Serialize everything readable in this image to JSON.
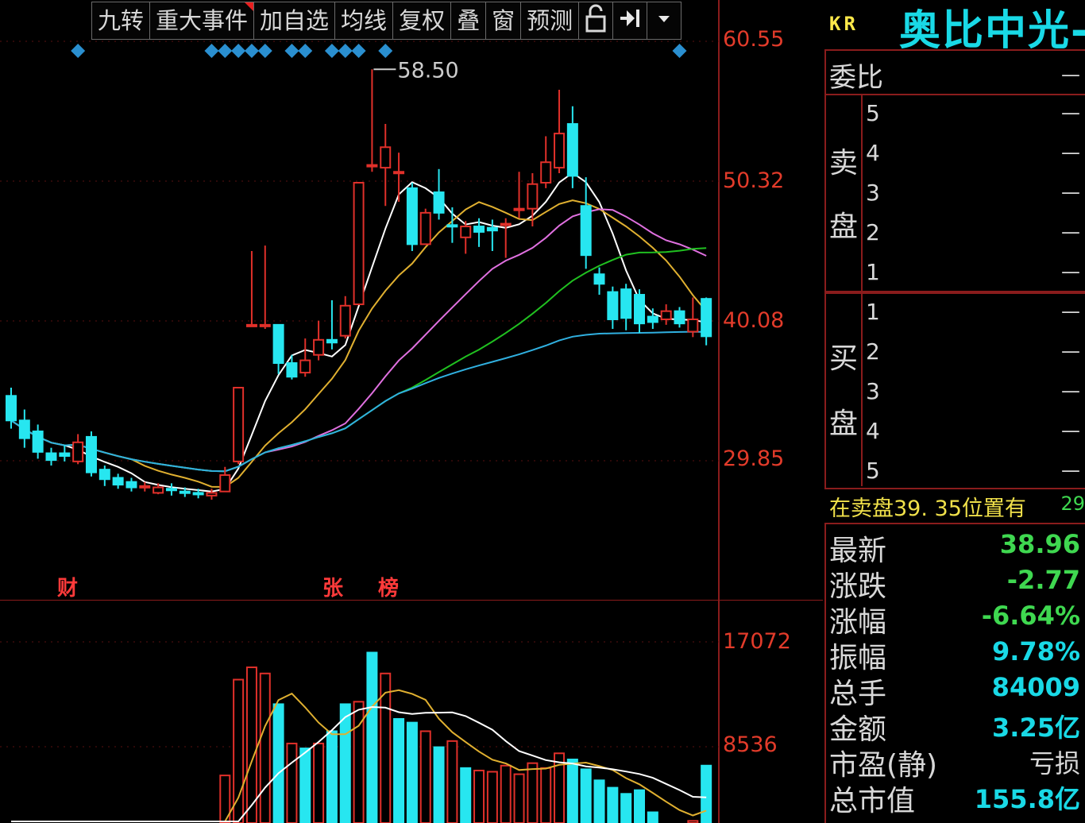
{
  "toolbar": {
    "buttons": [
      "九转",
      "重大事件",
      "加自选",
      "均线",
      "复权",
      "叠",
      "窗",
      "预测"
    ],
    "lock_icon": "lock-icon",
    "skip_icon": "skip-to-end-icon",
    "dropdown_icon": "chevron-down-icon"
  },
  "price_axis": [
    "60.55",
    "50.32",
    "40.08",
    "29.85"
  ],
  "volume_axis": [
    "17072",
    "8536"
  ],
  "annotations": {
    "high_label": "58.50",
    "events": [
      "财",
      "张",
      "榜"
    ]
  },
  "colors": {
    "up": "#e0302a",
    "down": "#27e6f0",
    "ma5": "#ffffff",
    "ma10": "#e0b030",
    "ma20": "#e070e0",
    "ma30": "#20c020",
    "ma60": "#30b0e0",
    "diamond": "#2a8fd0"
  },
  "chart_data": {
    "type": "candlestick",
    "y_ticks": [
      60.55,
      50.32,
      40.08,
      29.85
    ],
    "high_marker": 58.5,
    "candles": [
      [
        34.6,
        32.8,
        35.2,
        32.2
      ],
      [
        32.8,
        31.5,
        33.6,
        30.8
      ],
      [
        32.0,
        30.5,
        32.5,
        30.0
      ],
      [
        30.4,
        29.9,
        30.8,
        29.5
      ],
      [
        30.4,
        30.2,
        31.0,
        29.8
      ],
      [
        29.8,
        31.2,
        31.8,
        29.6
      ],
      [
        31.6,
        29.0,
        32.0,
        28.7
      ],
      [
        29.2,
        28.5,
        29.5,
        28.0
      ],
      [
        28.6,
        28.1,
        28.9,
        27.8
      ],
      [
        28.3,
        27.9,
        28.6,
        27.6
      ],
      [
        27.9,
        28.0,
        28.3,
        27.6
      ],
      [
        27.5,
        27.9,
        28.2,
        27.4
      ],
      [
        27.8,
        27.7,
        28.2,
        27.3
      ],
      [
        27.6,
        27.5,
        27.9,
        27.2
      ],
      [
        27.5,
        27.4,
        27.8,
        27.1
      ],
      [
        27.3,
        27.5,
        27.8,
        27.0
      ],
      [
        27.6,
        28.8,
        29.4,
        27.6
      ],
      [
        29.8,
        35.2,
        35.2,
        29.6
      ],
      [
        39.8,
        39.8,
        45.2,
        39.8
      ],
      [
        39.8,
        39.8,
        45.6,
        39.5
      ],
      [
        39.8,
        37.0,
        39.8,
        36.2
      ],
      [
        37.0,
        36.0,
        37.6,
        35.8
      ],
      [
        36.3,
        37.2,
        38.8,
        36.0
      ],
      [
        37.6,
        38.7,
        40.1,
        37.2
      ],
      [
        38.7,
        38.5,
        41.6,
        38.0
      ],
      [
        39.0,
        41.2,
        41.9,
        38.8
      ],
      [
        41.3,
        50.2,
        50.2,
        41.3
      ],
      [
        51.5,
        51.5,
        58.5,
        51.0
      ],
      [
        51.3,
        52.8,
        54.5,
        48.5
      ],
      [
        51.0,
        51.0,
        52.4,
        48.8
      ],
      [
        49.8,
        45.7,
        50.2,
        45.2
      ],
      [
        45.7,
        48.0,
        48.3,
        45.7
      ],
      [
        49.5,
        48.0,
        51.2,
        47.5
      ],
      [
        47.1,
        47.0,
        48.4,
        45.8
      ],
      [
        46.2,
        47.0,
        47.4,
        45.0
      ],
      [
        47.0,
        46.6,
        47.6,
        45.5
      ],
      [
        46.9,
        46.7,
        47.5,
        45.2
      ],
      [
        47.2,
        47.2,
        47.6,
        44.7
      ],
      [
        48.2,
        48.3,
        51.0,
        47.6
      ],
      [
        48.3,
        50.1,
        50.9,
        47.0
      ],
      [
        50.2,
        51.7,
        53.6,
        49.8
      ],
      [
        51.3,
        53.8,
        57.0,
        50.9
      ],
      [
        54.5,
        50.7,
        55.8,
        49.8
      ],
      [
        48.5,
        44.9,
        50.6,
        43.9
      ],
      [
        43.5,
        42.8,
        44.0,
        42.0
      ],
      [
        42.2,
        40.2,
        42.6,
        39.5
      ],
      [
        42.4,
        40.3,
        42.8,
        39.4
      ],
      [
        42.0,
        39.9,
        42.4,
        39.2
      ],
      [
        40.4,
        40.0,
        41.0,
        39.5
      ],
      [
        40.2,
        40.8,
        41.3,
        39.8
      ],
      [
        40.8,
        39.9,
        41.1,
        39.6
      ],
      [
        39.3,
        40.2,
        41.8,
        38.9
      ],
      [
        41.7,
        38.96,
        41.8,
        38.3
      ]
    ],
    "volume": [
      [
        2200,
        0
      ],
      [
        1500,
        0
      ],
      [
        900,
        0
      ],
      [
        700,
        0
      ],
      [
        600,
        0
      ],
      [
        400,
        0
      ],
      [
        300,
        0
      ],
      [
        250,
        1
      ],
      [
        300,
        1
      ],
      [
        200,
        1
      ],
      [
        250,
        1
      ],
      [
        220,
        1
      ],
      [
        180,
        1
      ],
      [
        200,
        1
      ],
      [
        150,
        1
      ],
      [
        1400,
        1
      ],
      [
        6200,
        1
      ],
      [
        14000,
        1
      ],
      [
        15000,
        1
      ],
      [
        14500,
        1
      ],
      [
        12000,
        0
      ],
      [
        8800,
        1
      ],
      [
        8400,
        0
      ],
      [
        8800,
        1
      ],
      [
        9800,
        0
      ],
      [
        12000,
        0
      ],
      [
        12200,
        1
      ],
      [
        16200,
        0
      ],
      [
        14500,
        1
      ],
      [
        10800,
        0
      ],
      [
        10500,
        0
      ],
      [
        9800,
        1
      ],
      [
        8500,
        0
      ],
      [
        9000,
        1
      ],
      [
        6800,
        0
      ],
      [
        6600,
        1
      ],
      [
        6500,
        1
      ],
      [
        7000,
        1
      ],
      [
        6300,
        1
      ],
      [
        7200,
        1
      ],
      [
        6800,
        1
      ],
      [
        8000,
        1
      ],
      [
        7500,
        0
      ],
      [
        6700,
        0
      ],
      [
        5800,
        0
      ],
      [
        5200,
        0
      ],
      [
        4700,
        0
      ],
      [
        5000,
        0
      ],
      [
        3200,
        0
      ],
      [
        2200,
        0
      ],
      [
        1800,
        0
      ],
      [
        2500,
        1
      ],
      [
        7000,
        0
      ]
    ]
  },
  "panel": {
    "code": "KR",
    "name": "奥比中光-",
    "weibi_label": "委比",
    "weibi_value": "—",
    "sell_label": [
      "卖",
      "盘"
    ],
    "buy_label": [
      "买",
      "盘"
    ],
    "sell_levels": [
      "5",
      "4",
      "3",
      "2",
      "1"
    ],
    "buy_levels": [
      "1",
      "2",
      "3",
      "4",
      "5"
    ],
    "dash": "—",
    "note": "在卖盘39. 35位置有",
    "note_value": "29",
    "stats": [
      {
        "label": "最新",
        "value": "38.96",
        "color": "green"
      },
      {
        "label": "涨跌",
        "value": "-2.77",
        "color": "green"
      },
      {
        "label": "涨幅",
        "value": "-6.64%",
        "color": "green"
      },
      {
        "label": "振幅",
        "value": "9.78%",
        "color": "cyan"
      },
      {
        "label": "总手",
        "value": "84009",
        "color": "cyan"
      },
      {
        "label": "金额",
        "value": "3.25亿",
        "color": "cyan"
      },
      {
        "label": "市盈(静)",
        "value": "亏损",
        "color": "plain"
      },
      {
        "label": "总市值",
        "value": "155.8亿",
        "color": "cyan"
      }
    ]
  }
}
